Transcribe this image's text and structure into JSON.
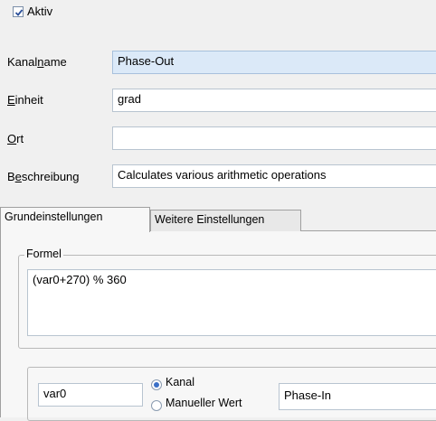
{
  "active": {
    "label": "Aktiv",
    "checked": true
  },
  "fields": {
    "channel_name": {
      "label_pre": "Kanal",
      "label_u": "n",
      "label_post": "ame",
      "value": "Phase-Out"
    },
    "unit": {
      "label_pre": "",
      "label_u": "E",
      "label_post": "inheit",
      "value": "grad"
    },
    "location": {
      "label_pre": "",
      "label_u": "O",
      "label_post": "rt",
      "value": ""
    },
    "description": {
      "label_pre": "B",
      "label_u": "e",
      "label_post": "schreibung",
      "value": "Calculates various arithmetic operations"
    }
  },
  "tabs": [
    {
      "label": "Grundeinstellungen",
      "active": true
    },
    {
      "label": "Weitere Einstellungen",
      "active": false
    }
  ],
  "formula": {
    "legend": "Formel",
    "value": "(var0+270) % 360"
  },
  "variable": {
    "name": "var0",
    "source_options": [
      {
        "label": "Kanal",
        "selected": true
      },
      {
        "label": "Manueller Wert",
        "selected": false
      }
    ],
    "channel": "Phase-In"
  }
}
